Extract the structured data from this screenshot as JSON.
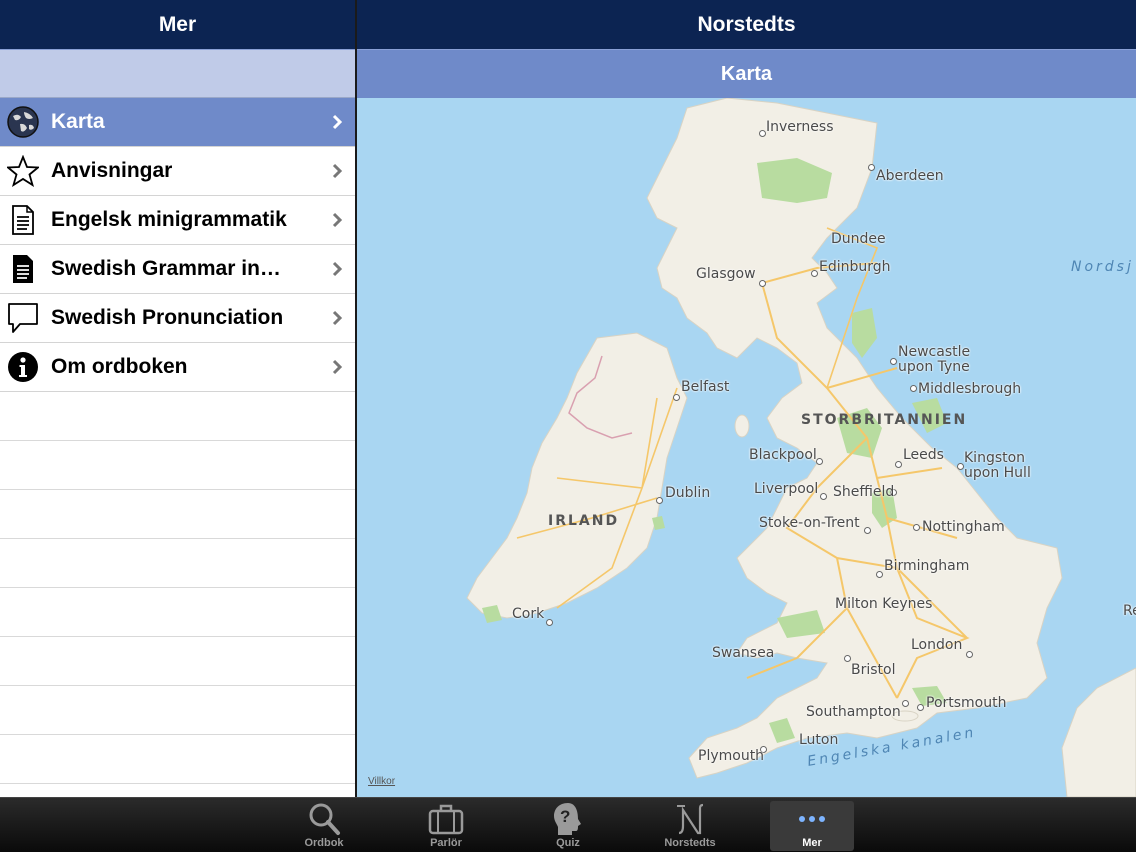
{
  "left_pane": {
    "title": "Mer",
    "items": [
      {
        "label": "Karta",
        "icon": "globe-icon",
        "selected": true
      },
      {
        "label": "Anvisningar",
        "icon": "star-icon",
        "selected": false
      },
      {
        "label": "Engelsk minigrammatik",
        "icon": "document-icon",
        "selected": false
      },
      {
        "label": "Swedish Grammar in…",
        "icon": "document-filled-icon",
        "selected": false
      },
      {
        "label": "Swedish Pronunciation",
        "icon": "speech-bubble-icon",
        "selected": false
      },
      {
        "label": "Om ordboken",
        "icon": "info-icon",
        "selected": false
      }
    ]
  },
  "right_pane": {
    "title": "Norstedts",
    "subtitle": "Karta"
  },
  "map": {
    "cities": {
      "inverness": "Inverness",
      "aberdeen": "Aberdeen",
      "dundee": "Dundee",
      "glasgow": "Glasgow",
      "edinburgh": "Edinburgh",
      "newcastle": "Newcastle\nupon Tyne",
      "middlesbrough": "Middlesbrough",
      "belfast": "Belfast",
      "blackpool": "Blackpool",
      "leeds": "Leeds",
      "kingston": "Kingston\nupon Hull",
      "dublin": "Dublin",
      "liverpool": "Liverpool",
      "sheffield": "Sheffield",
      "stoke": "Stoke-on-Trent",
      "nottingham": "Nottingham",
      "birmingham": "Birmingham",
      "cork": "Cork",
      "milton_keynes": "Milton Keynes",
      "london": "London",
      "swansea": "Swansea",
      "bristol": "Bristol",
      "southampton": "Southampton",
      "portsmouth": "Portsmouth",
      "luton": "Luton",
      "plymouth": "Plymouth"
    },
    "countries": {
      "uk": "STORBRITANNIEN",
      "ireland": "IRLAND"
    },
    "seas": {
      "north_sea": "Nordsj",
      "channel": "Engelska kanalen",
      "edge_label": "Re"
    },
    "terms": "Villkor",
    "colors": {
      "water": "#a9d6f2",
      "land": "#f2efe6",
      "park": "#b8dca0",
      "road": "#f5c76a"
    }
  },
  "tabbar": {
    "tabs": [
      {
        "label": "Ordbok",
        "icon": "magnifier-icon",
        "active": false
      },
      {
        "label": "Parlör",
        "icon": "suitcase-icon",
        "active": false
      },
      {
        "label": "Quiz",
        "icon": "question-head-icon",
        "active": false
      },
      {
        "label": "Norstedts",
        "icon": "norstedts-n-icon",
        "active": false
      },
      {
        "label": "Mer",
        "icon": "more-dots-icon",
        "active": true
      }
    ]
  }
}
